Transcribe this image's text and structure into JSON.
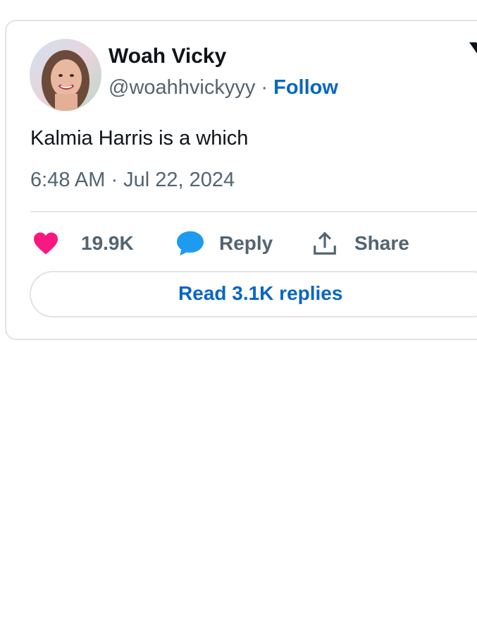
{
  "tweet": {
    "author": {
      "display_name": "Woah Vicky",
      "handle": "@woahhvickyyy",
      "separator": " · ",
      "follow_label": "Follow"
    },
    "text": "Kalmia Harris is a which",
    "timestamp": "6:48 AM · Jul 22, 2024",
    "actions": {
      "like_count": "19.9K",
      "reply_label": "Reply",
      "share_label": "Share"
    },
    "read_replies_label": "Read 3.1K replies"
  },
  "colors": {
    "like": "#f91880",
    "reply": "#1d9bf0",
    "link": "#0a66c2",
    "muted": "#536471",
    "text": "#0f1419"
  },
  "icons": [
    "avatar",
    "x-logo-icon",
    "heart-icon",
    "reply-bubble-icon",
    "share-icon"
  ]
}
